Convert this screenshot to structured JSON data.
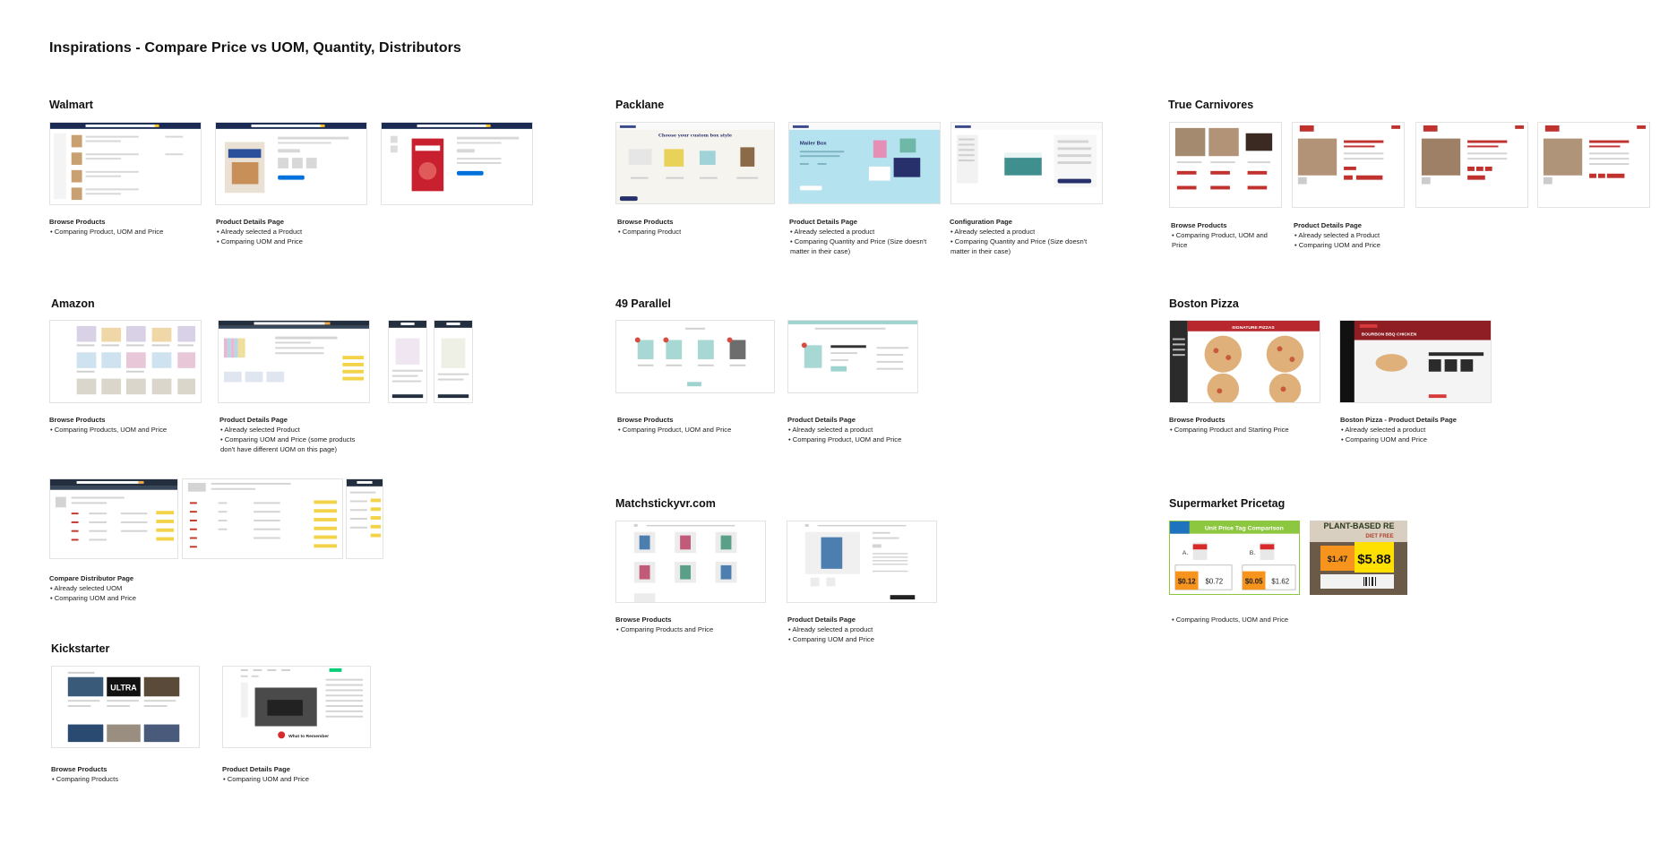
{
  "page": {
    "title": "Inspirations - Compare Price vs UOM, Quantity, Distributors"
  },
  "sections": {
    "walmart": {
      "name": "Walmart"
    },
    "packlane": {
      "name": "Packlane"
    },
    "true_carnivores": {
      "name": "True Carnivores"
    },
    "amazon": {
      "name": "Amazon"
    },
    "parallel49": {
      "name": "49 Parallel"
    },
    "boston_pizza": {
      "name": "Boston Pizza"
    },
    "matchsticky": {
      "name": "Matchstickyvr.com"
    },
    "supermarket": {
      "name": "Supermarket Pricetag"
    },
    "kickstarter": {
      "name": "Kickstarter"
    }
  },
  "captions": {
    "walmart_browse": {
      "title": "Browse Products",
      "bullets": [
        "• Comparing Product, UOM and Price"
      ]
    },
    "walmart_pdp": {
      "title": "Product Details Page",
      "bullets": [
        "• Already selected a Product",
        "• Comparing UOM and Price"
      ]
    },
    "packlane_browse": {
      "title": "Browse Products",
      "bullets": [
        "• Comparing Product"
      ]
    },
    "packlane_pdp": {
      "title": "Product Details Page",
      "bullets": [
        "• Already selected a product",
        "• Comparing Quantity and Price (Size doesn't",
        "matter in their case)"
      ]
    },
    "packlane_config": {
      "title": "Configuration Page",
      "bullets": [
        "• Already selected a product",
        "• Comparing Quantity and Price (Size doesn't",
        "matter in their case)"
      ]
    },
    "tc_browse": {
      "title": "Browse Products",
      "bullets": [
        "• Comparing Product, UOM and",
        "Price"
      ]
    },
    "tc_pdp": {
      "title": "Product Details Page",
      "bullets": [
        "• Already selected a Product",
        "• Comparing UOM and Price"
      ]
    },
    "amazon_browse": {
      "title": "Browse Products",
      "bullets": [
        "• Comparing Products, UOM and Price"
      ]
    },
    "amazon_pdp": {
      "title": "Product Details Page",
      "bullets": [
        "• Already selected Product",
        "• Comparing UOM and Price (some products",
        "don't have different UOM on this page)"
      ]
    },
    "p49_browse": {
      "title": "Browse Products",
      "bullets": [
        "• Comparing Product, UOM and Price"
      ]
    },
    "p49_pdp": {
      "title": "Product Details Page",
      "bullets": [
        "• Already selected a product",
        "• Comparing Product, UOM and Price"
      ]
    },
    "bp_browse": {
      "title": "Browse Products",
      "bullets": [
        "• Comparing Product and Starting Price"
      ]
    },
    "bp_pdp": {
      "title": "Boston Pizza - Product Details Page",
      "bullets": [
        "• Already selected a product",
        "• Comparing UOM and Price"
      ]
    },
    "amazon_compare": {
      "title": "Compare Distributor Page",
      "bullets": [
        "• Already selected UOM",
        "• Comparing UOM and Price"
      ]
    },
    "ms_browse": {
      "title": "Browse Products",
      "bullets": [
        "• Comparing Products and Price"
      ]
    },
    "ms_pdp": {
      "title": "Product Details Page",
      "bullets": [
        "• Already selected a product",
        "• Comparing UOM and Price"
      ]
    },
    "sm_caption": {
      "title": "",
      "bullets": [
        "• Comparing Products, UOM and Price"
      ]
    },
    "ks_browse": {
      "title": "Browse Products",
      "bullets": [
        "• Comparing Products"
      ]
    },
    "ks_pdp": {
      "title": "Product Details Page",
      "bullets": [
        "• Comparing UOM and Price"
      ]
    }
  },
  "thumb_text": {
    "packlane_headline": "Choose your custom box style",
    "packlane_mailer": "Mailer Box",
    "bp_pizza_header": "SIGNATURE PIZZAS",
    "bp_bbq": "BOURBON BBQ CHICKEN",
    "tag_banner": "Unit Price Tag Comparison",
    "tag_price_a": "$0.12",
    "tag_total_a": "$0.72",
    "tag_price_b": "$0.05",
    "tag_total_b": "$1.62",
    "tag_photo_headline": "PLANT-BASED RE",
    "tag_photo_sub": "DIET FREE",
    "tag_photo_price": "$5.88",
    "tag_photo_small": "$1.47",
    "ks_ultra": "ULTRA",
    "ks_help": "What to Remember"
  },
  "colors": {
    "walmart_nav": "#1b2a52",
    "walmart_yellow": "#ffc220",
    "amazon_nav": "#232f3e",
    "amazon_orange": "#f3a847",
    "packlane_teal": "#b4e2ef",
    "tc_red": "#c0322e",
    "p49_teal": "#9fd3cf",
    "bp_red": "#b7272d",
    "tag_green": "#8dc63f",
    "tag_orange": "#f7941d",
    "tag_yellow": "#ffe000"
  }
}
